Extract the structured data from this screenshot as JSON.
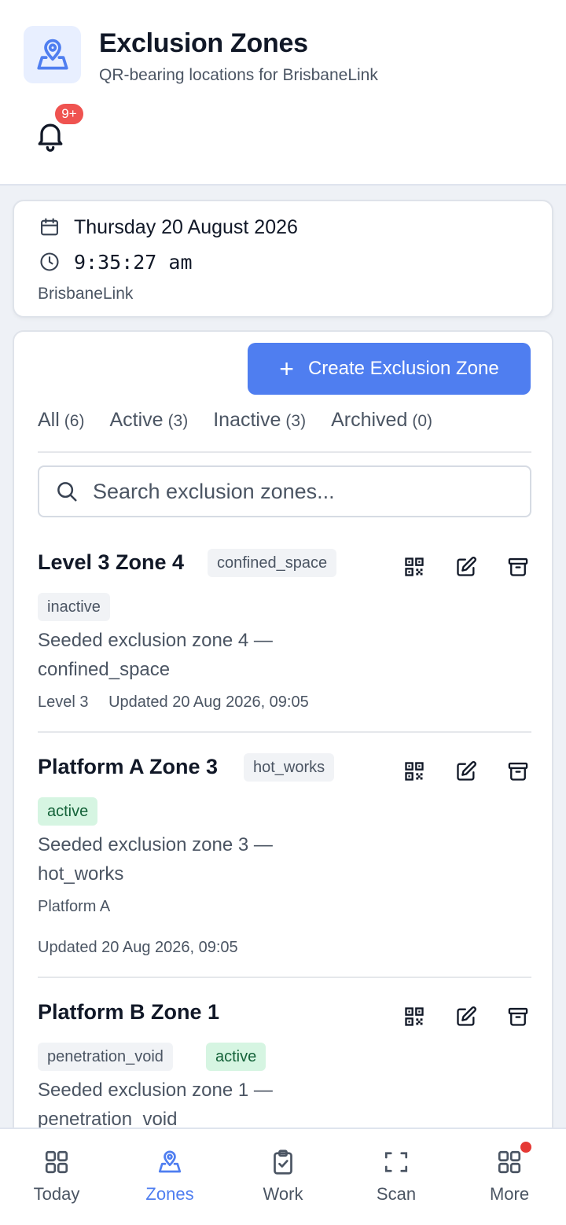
{
  "header": {
    "title": "Exclusion Zones",
    "subtitle": "QR-bearing locations for BrisbaneLink",
    "notification_badge": "9+",
    "icon": "map-pin-icon"
  },
  "datecard": {
    "date": "Thursday 20 August 2026",
    "time": "9:35:27 am",
    "org": "BrisbaneLink"
  },
  "main": {
    "create_label": "Create Exclusion Zone",
    "tabs": [
      {
        "label": "All",
        "count": "(6)"
      },
      {
        "label": "Active",
        "count": "(3)"
      },
      {
        "label": "Inactive",
        "count": "(3)"
      },
      {
        "label": "Archived",
        "count": "(0)"
      }
    ],
    "search_placeholder": "Search exclusion zones...",
    "zones": [
      {
        "name": "Level 3 Zone 4",
        "type": "confined_space",
        "status": "inactive",
        "desc1": "Seeded exclusion zone 4 —",
        "desc2": "confined_space",
        "location": "Level 3",
        "updated": "Updated 20 Aug 2026, 09:05"
      },
      {
        "name": "Platform A Zone 3",
        "type": "hot_works",
        "status": "active",
        "desc1": "Seeded exclusion zone 3 —",
        "desc2": "hot_works",
        "location": "Platform A",
        "updated": "Updated 20 Aug 2026, 09:05"
      },
      {
        "name": "Platform B Zone 1",
        "type": "penetration_void",
        "status": "active",
        "desc1": "Seeded exclusion zone 1 —",
        "desc2": "penetration_void"
      }
    ]
  },
  "nav": [
    {
      "label": "Today",
      "icon": "grid-icon"
    },
    {
      "label": "Zones",
      "icon": "map-pin-icon",
      "selected": true
    },
    {
      "label": "Work",
      "icon": "clipboard-check-icon"
    },
    {
      "label": "Scan",
      "icon": "scan-frame-icon"
    },
    {
      "label": "More",
      "icon": "grid-icon"
    }
  ],
  "colors": {
    "accent": "#4f7ef0",
    "active_bg": "#d6f5e2",
    "active_text": "#15633a",
    "badge": "#ef5350"
  }
}
